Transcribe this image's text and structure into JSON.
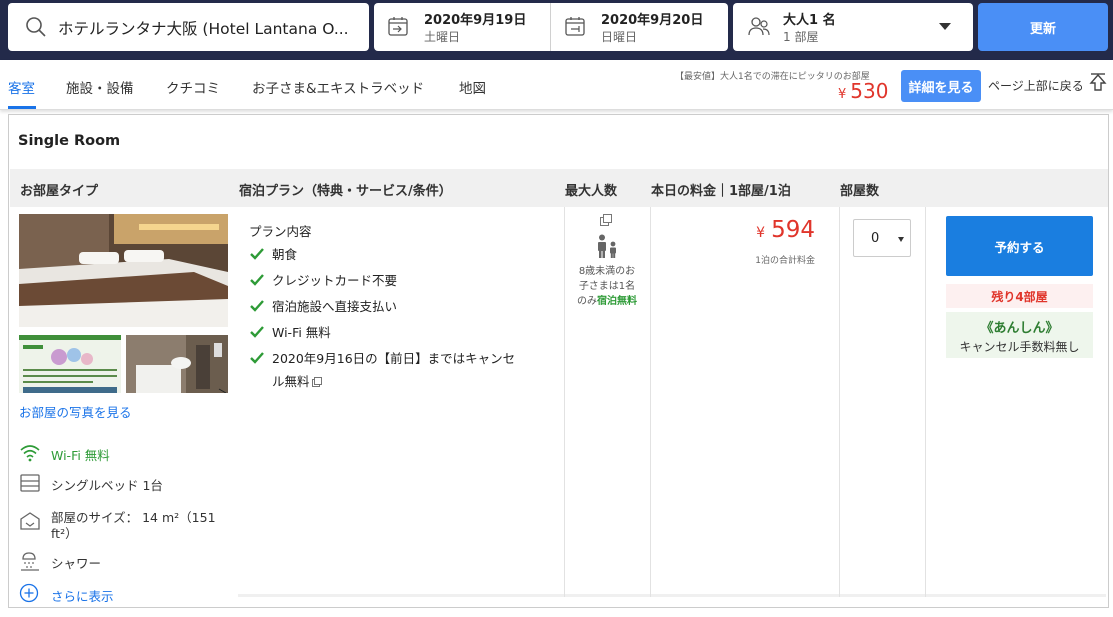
{
  "search": {
    "query": "ホテルランタナ大阪 (Hotel Lantana O...",
    "checkin_date": "2020年9月19日",
    "checkin_day": "土曜日",
    "checkout_date": "2020年9月20日",
    "checkout_day": "日曜日",
    "guests": "大人1 名",
    "rooms": "1 部屋",
    "update_label": "更新"
  },
  "tabs": [
    {
      "label": "客室"
    },
    {
      "label": "施設・設備"
    },
    {
      "label": "クチコミ"
    },
    {
      "label": "お子さま&エキストラベッド"
    },
    {
      "label": "地図"
    }
  ],
  "summary": {
    "lowest_label": "【最安値】大人1名での滞在にピッタリのお部屋",
    "currency": "¥",
    "lowest_price": "530",
    "detail_label": "詳細を見る",
    "back_to_top": "ページ上部に戻る"
  },
  "room": {
    "title": "Single Room",
    "headers": {
      "room_type": "お部屋タイプ",
      "plan": "宿泊プラン（特典・サービス/条件）",
      "max_people": "最大人数",
      "price": "本日の料金｜1部屋/1泊",
      "room_count": "部屋数"
    },
    "photos_link": "お部屋の写真を見る",
    "amenities": [
      {
        "icon": "wifi-icon",
        "label": "Wi-Fi 無料"
      },
      {
        "icon": "bed-icon",
        "label": "シングルベッド 1台"
      },
      {
        "icon": "room-size-icon",
        "label": "部屋のサイズ： 14 m²（151",
        "label2": "ft²）"
      },
      {
        "icon": "shower-icon",
        "label": "シャワー"
      }
    ],
    "show_more": "さらに表示",
    "plan": {
      "heading": "プラン内容",
      "items": [
        "朝食",
        "クレジットカード不要",
        "宿泊施設へ直接支払い",
        "Wi-Fi 無料",
        "2020年9月16日の【前日】まではキャンセ"
      ],
      "item5_line2": "ル無料"
    },
    "capacity_note": {
      "line1": "8歳未満のお",
      "line2": "子さまは1名",
      "line3_prefix": "のみ",
      "line3_free": "宿泊無料"
    },
    "price": "594",
    "price_note": "1泊の合計料金",
    "room_count_value": "0",
    "reserve_label": "予約する",
    "rooms_left": "残り4部屋",
    "anshin_title": "《あんしん》",
    "anshin_note": "キャンセル手数料無し"
  },
  "colors": {
    "header_bg": "#232a4a",
    "accent_blue": "#1a73e8",
    "button_blue": "#4a8ff6",
    "price_red": "#e0352b",
    "check_green": "#2e9b37"
  }
}
